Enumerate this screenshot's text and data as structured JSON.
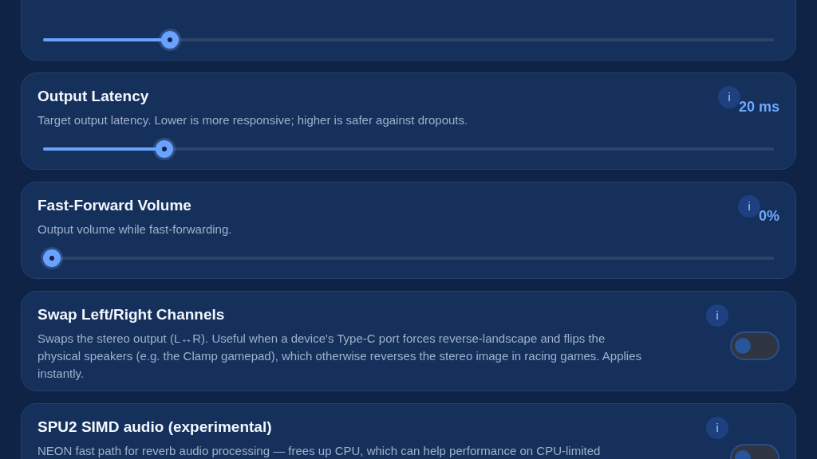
{
  "settings": [
    {
      "kind": "slider",
      "level": 0.166
    },
    {
      "kind": "slider",
      "title": "Output Latency",
      "description": "Target output latency. Lower is more responsive; higher is safer against dropouts.",
      "info": "i",
      "value": "20 ms",
      "level": 0.158
    },
    {
      "kind": "slider",
      "title": "Fast-Forward Volume",
      "description": "Output volume while fast-forwarding.",
      "info": "i",
      "value": "0%",
      "level": 0
    },
    {
      "kind": "toggle",
      "title": "Swap Left/Right Channels",
      "description": "Swaps the stereo output (L↔R). Useful when a device's Type-C port forces reverse-landscape and flips the physical speakers (e.g. the Clamp gamepad), which otherwise reverses the stereo image in racing games. Applies instantly.",
      "info": "i",
      "on": false
    },
    {
      "kind": "toggle",
      "title": "SPU2 SIMD audio (experimental)",
      "description": "NEON fast path for reverb audio processing — frees up CPU, which can help performance on CPU-limited",
      "info": "i",
      "on": false
    }
  ]
}
